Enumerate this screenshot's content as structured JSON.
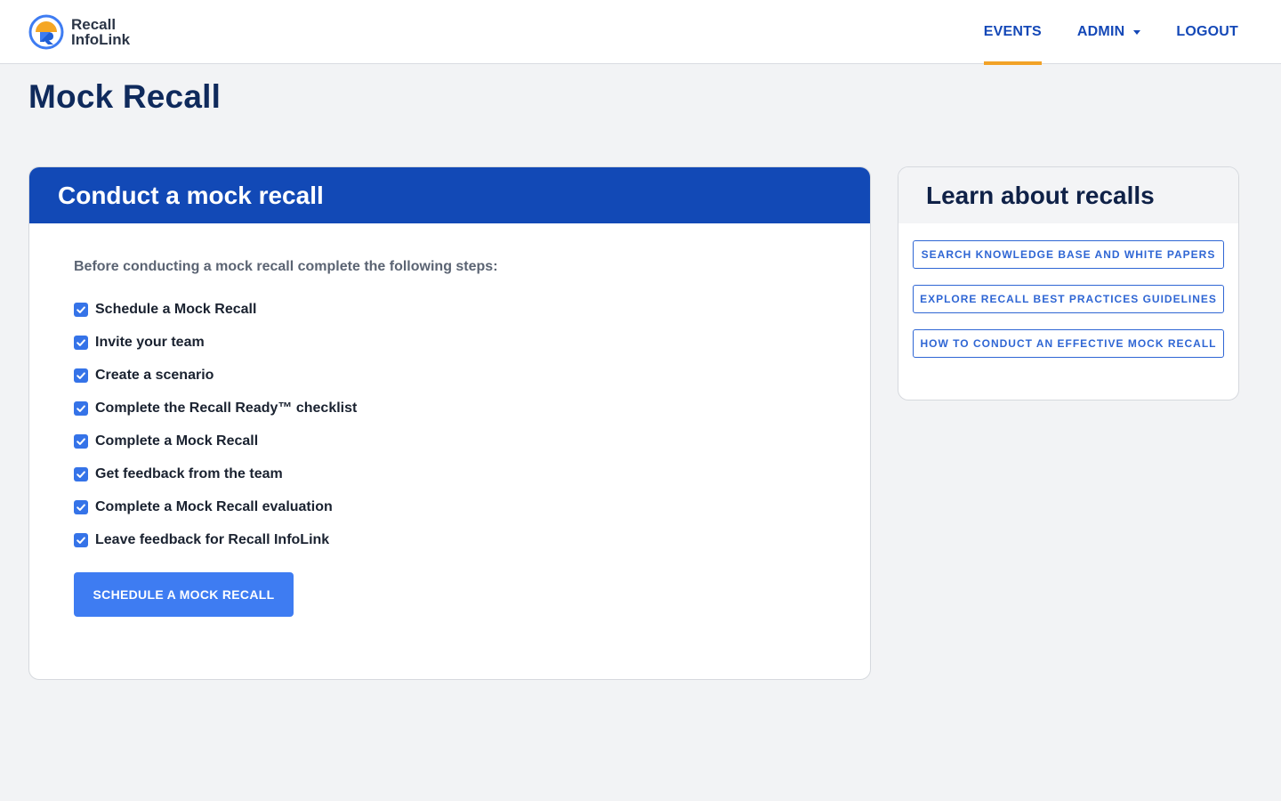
{
  "brand": {
    "line1": "Recall",
    "line2": "InfoLink"
  },
  "nav": {
    "events": "EVENTS",
    "admin": "ADMIN",
    "logout": "LOGOUT",
    "active": "EVENTS"
  },
  "page": {
    "title": "Mock Recall"
  },
  "conduct": {
    "title": "Conduct a mock recall",
    "intro": "Before conducting a mock recall complete the following steps:",
    "steps": [
      {
        "label": "Schedule a Mock Recall",
        "checked": true
      },
      {
        "label": "Invite your team",
        "checked": true
      },
      {
        "label": "Create a scenario",
        "checked": true
      },
      {
        "label": "Complete the Recall Ready™ checklist",
        "checked": true
      },
      {
        "label": "Complete a Mock Recall",
        "checked": true
      },
      {
        "label": "Get feedback from the team",
        "checked": true
      },
      {
        "label": "Complete a Mock Recall evaluation",
        "checked": true
      },
      {
        "label": "Leave feedback for Recall InfoLink",
        "checked": true
      }
    ],
    "button": "SCHEDULE A MOCK RECALL"
  },
  "learn": {
    "title": "Learn about recalls",
    "links": [
      "SEARCH KNOWLEDGE BASE AND WHITE PAPERS",
      "EXPLORE RECALL BEST PRACTICES GUIDELINES",
      "HOW TO CONDUCT AN EFFECTIVE MOCK RECALL"
    ]
  },
  "colors": {
    "primary": "#1249b6",
    "button": "#3e7cf2",
    "accent_underline": "#f2a227",
    "checkbox": "#3573e8"
  }
}
